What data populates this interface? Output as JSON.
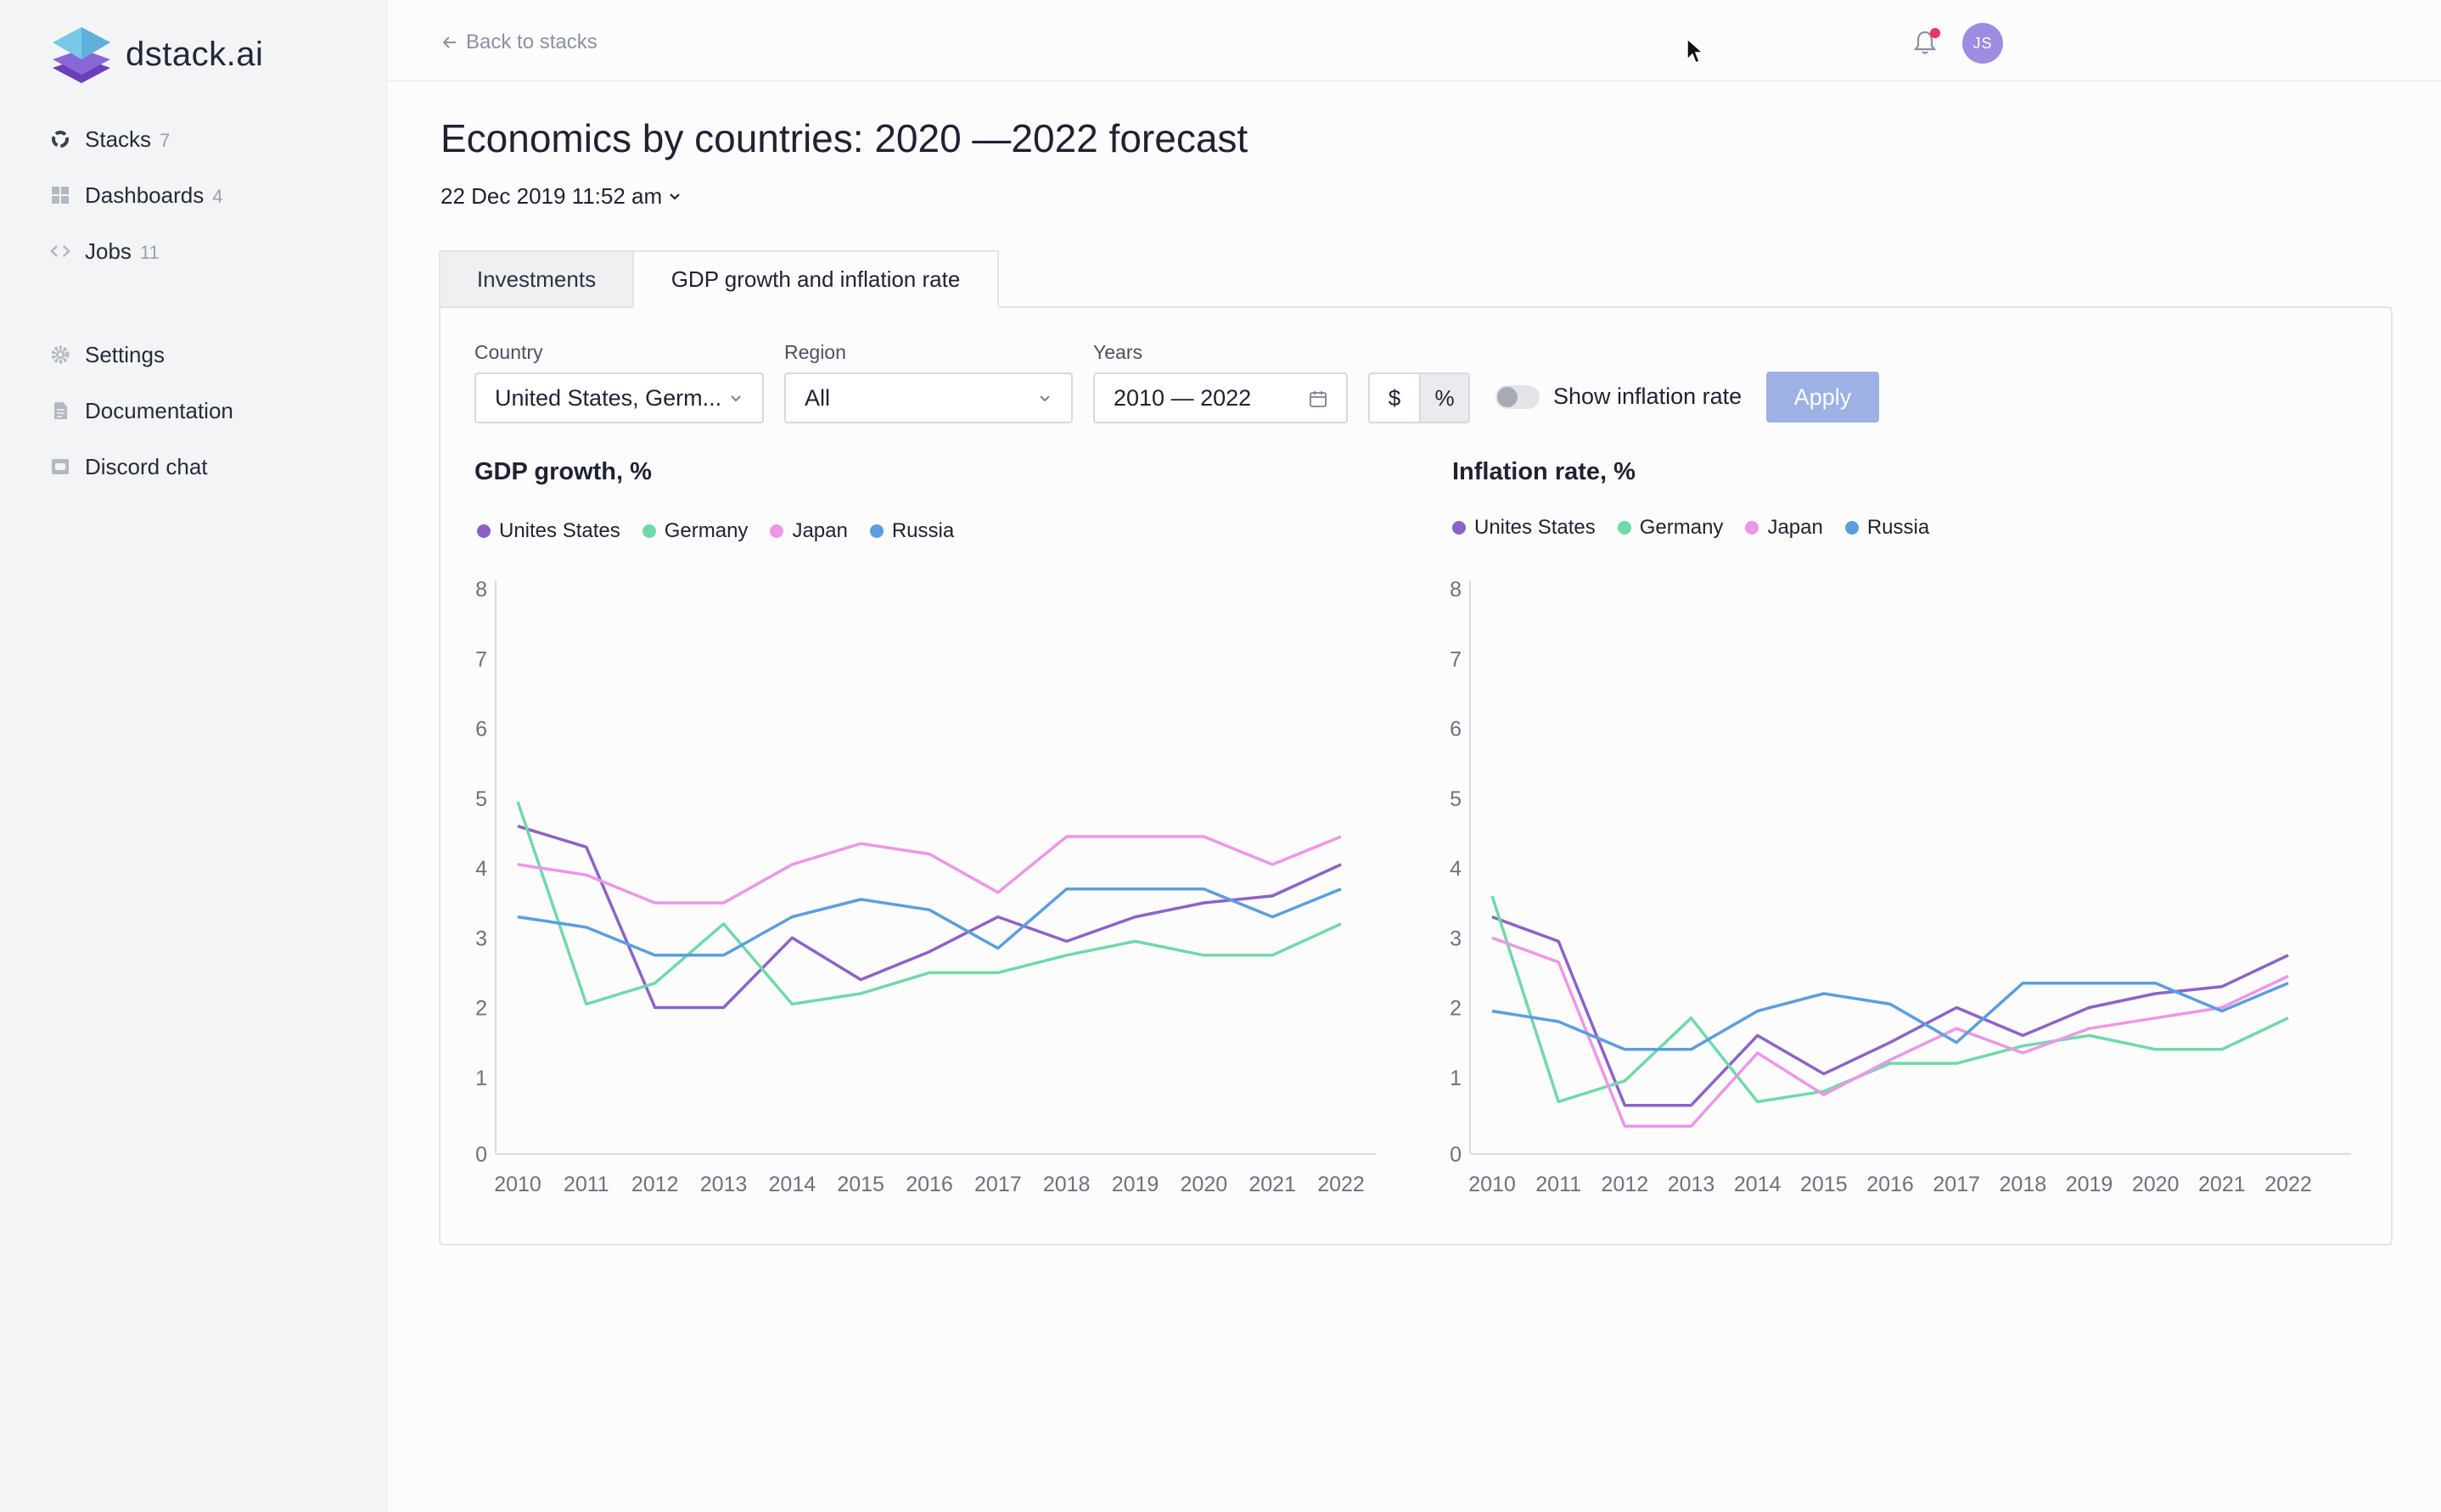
{
  "app": {
    "brand": "dstack.ai"
  },
  "sidebar": {
    "items": [
      {
        "label": "Stacks",
        "count": "7",
        "icon": "stacks-icon"
      },
      {
        "label": "Dashboards",
        "count": "4",
        "icon": "dashboards-icon"
      },
      {
        "label": "Jobs",
        "count": "11",
        "icon": "code-icon"
      }
    ],
    "secondary": [
      {
        "label": "Settings",
        "icon": "gear-icon"
      },
      {
        "label": "Documentation",
        "icon": "document-icon"
      },
      {
        "label": "Discord chat",
        "icon": "chat-icon"
      }
    ]
  },
  "topbar": {
    "back_label": "Back to stacks",
    "avatar_initials": "JS"
  },
  "page": {
    "title": "Economics by countries: 2020 —2022 forecast",
    "date": "22 Dec 2019 11:52 am"
  },
  "tabs": [
    {
      "label": "Investments"
    },
    {
      "label": "GDP growth and inflation rate"
    }
  ],
  "filters": {
    "country": {
      "label": "Country",
      "value": "United States, Germ..."
    },
    "region": {
      "label": "Region",
      "value": "All"
    },
    "years": {
      "label": "Years",
      "value": "2010 — 2022"
    },
    "unit_dollar": "$",
    "unit_percent": "%",
    "inflation_toggle_label": "Show inflation rate",
    "apply_label": "Apply"
  },
  "colors": {
    "us": "#8d62c8",
    "germany": "#6fdaa8",
    "japan": "#ee96e6",
    "russia": "#5b9ee0",
    "apply": "#9db1e4"
  },
  "chart_data": [
    {
      "type": "line",
      "title": "GDP growth, %",
      "x": [
        "2010",
        "2011",
        "2012",
        "2013",
        "2014",
        "2015",
        "2016",
        "2017",
        "2018",
        "2019",
        "2020",
        "2021",
        "2022"
      ],
      "ylim": [
        0,
        8
      ],
      "yticks": [
        "0",
        "1",
        "2",
        "3",
        "4",
        "5",
        "6",
        "7",
        "8"
      ],
      "series": [
        {
          "name": "Unites States",
          "color": "#8d62c8",
          "values": [
            4.6,
            4.3,
            2.0,
            2.0,
            3.0,
            2.4,
            2.8,
            3.3,
            2.95,
            3.3,
            3.5,
            3.6,
            4.05
          ]
        },
        {
          "name": "Germany",
          "color": "#6fdaa8",
          "values": [
            4.95,
            2.05,
            2.35,
            3.2,
            2.05,
            2.2,
            2.5,
            2.5,
            2.75,
            2.95,
            2.75,
            2.75,
            3.2
          ]
        },
        {
          "name": "Japan",
          "color": "#ee96e6",
          "values": [
            4.05,
            3.9,
            3.5,
            3.5,
            4.05,
            4.35,
            4.2,
            3.65,
            4.45,
            4.45,
            4.45,
            4.05,
            4.45
          ]
        },
        {
          "name": "Russia",
          "color": "#5b9ee0",
          "values": [
            3.3,
            3.15,
            2.75,
            2.75,
            3.3,
            3.55,
            3.4,
            2.85,
            3.7,
            3.7,
            3.7,
            3.3,
            3.7
          ]
        }
      ]
    },
    {
      "type": "line",
      "title": "Inflation rate, %",
      "x": [
        "2010",
        "2011",
        "2012",
        "2013",
        "2014",
        "2015",
        "2016",
        "2017",
        "2018",
        "2019",
        "2020",
        "2021",
        "2022"
      ],
      "ylim": [
        0,
        8
      ],
      "yticks": [
        "0",
        "1",
        "2",
        "3",
        "4",
        "5",
        "6",
        "7",
        "8"
      ],
      "series": [
        {
          "name": "Unites States",
          "color": "#8d62c8",
          "values": [
            3.3,
            2.95,
            0.6,
            0.6,
            1.6,
            1.05,
            1.5,
            2.0,
            1.6,
            2.0,
            2.2,
            2.3,
            2.75
          ]
        },
        {
          "name": "Germany",
          "color": "#6fdaa8",
          "values": [
            3.6,
            0.65,
            0.95,
            1.85,
            0.65,
            0.8,
            1.2,
            1.2,
            1.45,
            1.6,
            1.4,
            1.4,
            1.85
          ]
        },
        {
          "name": "Japan",
          "color": "#ee96e6",
          "values": [
            3.0,
            2.65,
            0.3,
            0.3,
            1.35,
            0.75,
            1.25,
            1.7,
            1.35,
            1.7,
            1.85,
            2.0,
            2.45
          ]
        },
        {
          "name": "Russia",
          "color": "#5b9ee0",
          "values": [
            1.95,
            1.8,
            1.4,
            1.4,
            1.95,
            2.2,
            2.05,
            1.5,
            2.35,
            2.35,
            2.35,
            1.95,
            2.35
          ]
        }
      ]
    }
  ]
}
